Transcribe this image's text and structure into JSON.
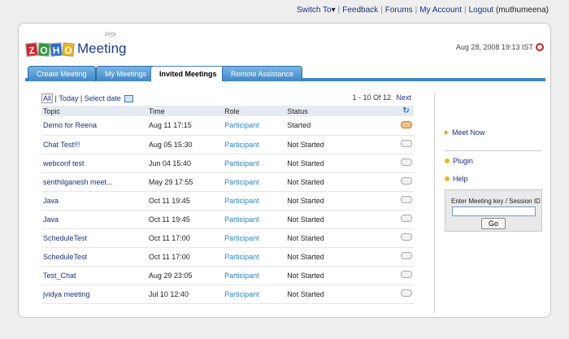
{
  "topnav": {
    "switch_to": "Switch To",
    "feedback": "Feedback",
    "forums": "Forums",
    "my_account": "My Account",
    "logout": "Logout",
    "user": "(muthumeena)"
  },
  "header": {
    "logo_letters": [
      "Z",
      "O",
      "H",
      "O"
    ],
    "app_name": "Meeting",
    "beta": "beta",
    "datetime": "Aug 28, 2008 19:13 IST"
  },
  "tabs": [
    {
      "label": "Create Meeting",
      "active": false
    },
    {
      "label": "My Meetings",
      "active": false
    },
    {
      "label": "Invited Meetings",
      "active": true
    },
    {
      "label": "Remote Assistance",
      "active": false
    }
  ],
  "filters": {
    "all": "All",
    "today": "Today",
    "select_date": "Select date"
  },
  "pager": {
    "range": "1 - 10 Of 12",
    "next": "Next"
  },
  "table": {
    "columns": [
      "Topic",
      "Time",
      "Role",
      "Status"
    ],
    "rows": [
      {
        "topic": "Demo for Reena",
        "time": "Aug 11 17:15",
        "role": "Participant",
        "status": "Started",
        "live": true
      },
      {
        "topic": "Chat Test!!!",
        "time": "Aug 05 15:30",
        "role": "Participant",
        "status": "Not Started",
        "live": false
      },
      {
        "topic": "webconf test",
        "time": "Jun 04 15:40",
        "role": "Participant",
        "status": "Not Started",
        "live": false
      },
      {
        "topic": "senthilganesh meet...",
        "time": "May 29 17:55",
        "role": "Participant",
        "status": "Not Started",
        "live": false
      },
      {
        "topic": "Java",
        "time": "Oct 11 19:45",
        "role": "Participant",
        "status": "Not Started",
        "live": false
      },
      {
        "topic": "Java",
        "time": "Oct 11 19:45",
        "role": "Participant",
        "status": "Not Started",
        "live": false
      },
      {
        "topic": "ScheduleTest",
        "time": "Oct 11 17:00",
        "role": "Participant",
        "status": "Not Started",
        "live": false
      },
      {
        "topic": "ScheduleTest",
        "time": "Oct 11 17:00",
        "role": "Participant",
        "status": "Not Started",
        "live": false
      },
      {
        "topic": "Test_Chat",
        "time": "Aug 29 23:05",
        "role": "Participant",
        "status": "Not Started",
        "live": false
      },
      {
        "topic": "jvidya meeting",
        "time": "Jul 10 12:40",
        "role": "Participant",
        "status": "Not Started",
        "live": false
      }
    ]
  },
  "sidebar": {
    "meet_now": "Meet Now",
    "plugin": "Plugin",
    "help": "Help",
    "key_label": "Enter Meeting key / Session ID",
    "key_value": "",
    "go": "Go"
  },
  "colors": {
    "tab_blue": "#3d86c6",
    "link": "#1a2f80",
    "role": "#2a85c9"
  }
}
